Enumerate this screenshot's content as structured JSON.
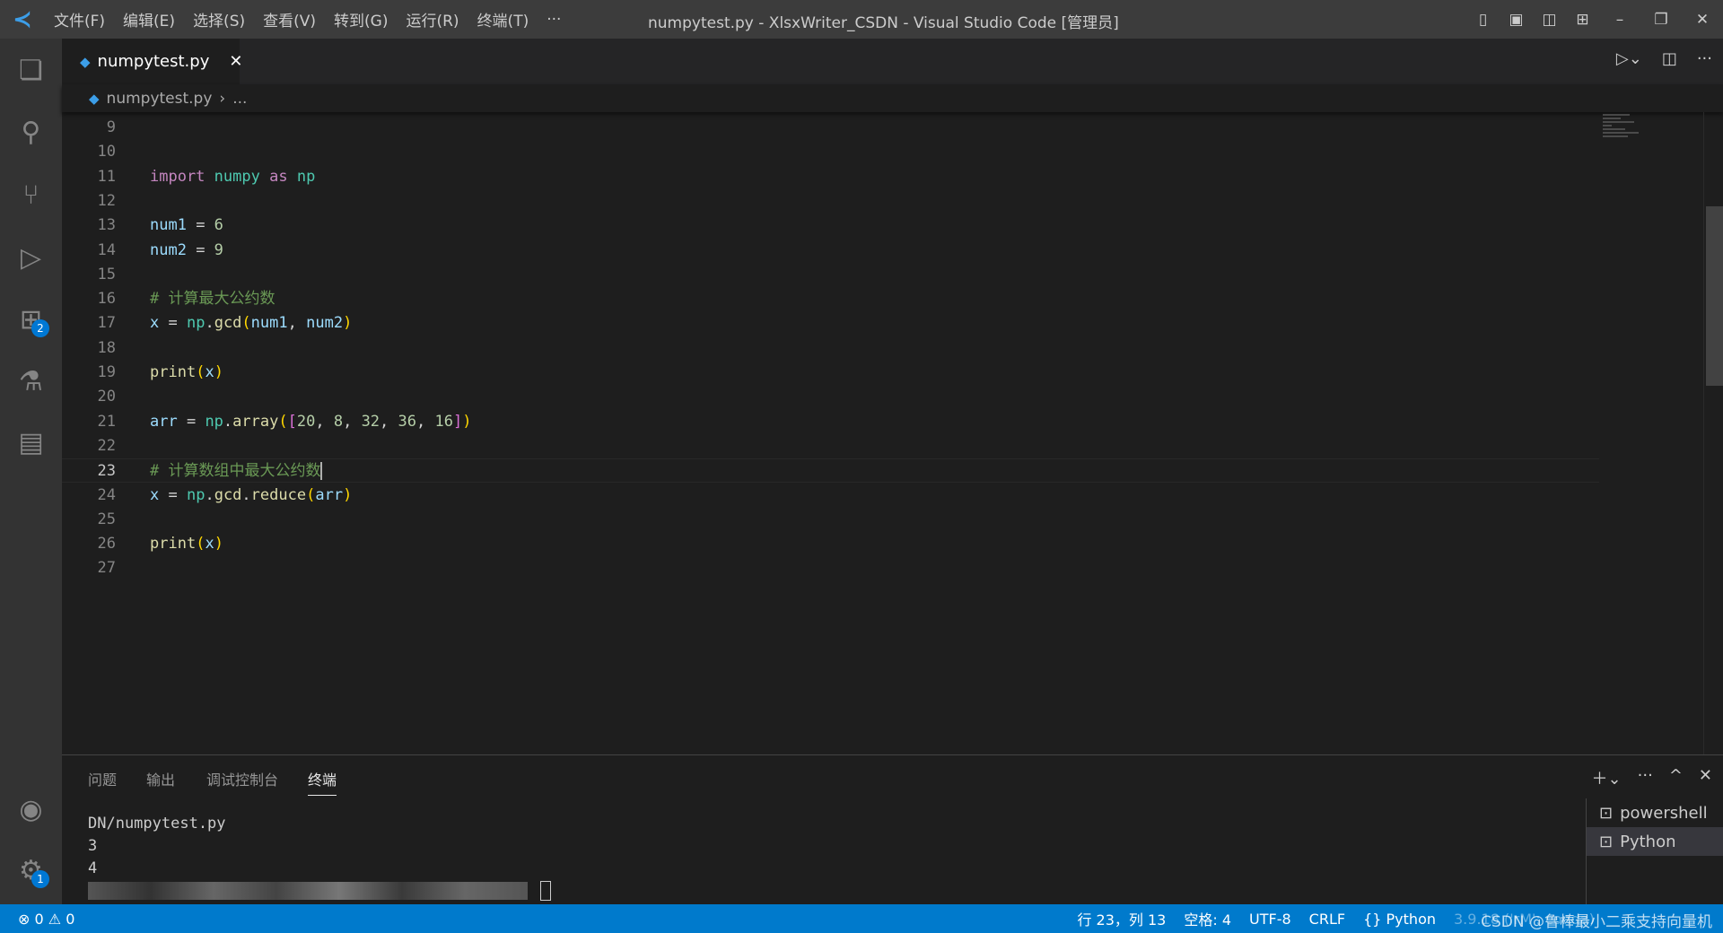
{
  "window": {
    "title": "numpytest.py - XlsxWriter_CSDN - Visual Studio Code [管理员]",
    "more": "···"
  },
  "menu": [
    "文件(F)",
    "编辑(E)",
    "选择(S)",
    "查看(V)",
    "转到(G)",
    "运行(R)",
    "终端(T)"
  ],
  "tab": {
    "label": "numpytest.py",
    "close": "✕"
  },
  "breadcrumb": {
    "file": "numpytest.py",
    "sep": "›",
    "rest": "..."
  },
  "activity": {
    "extensions_badge": "2",
    "settings_badge": "1"
  },
  "editor": {
    "current_line": 23,
    "lines": [
      {
        "n": "9",
        "t": []
      },
      {
        "n": "10",
        "t": []
      },
      {
        "n": "11",
        "t": [
          [
            "kw",
            "import"
          ],
          [
            "op",
            " "
          ],
          [
            "mod",
            "numpy"
          ],
          [
            "op",
            " "
          ],
          [
            "kw",
            "as"
          ],
          [
            "op",
            " "
          ],
          [
            "mod",
            "np"
          ]
        ]
      },
      {
        "n": "12",
        "t": []
      },
      {
        "n": "13",
        "t": [
          [
            "var",
            "num1"
          ],
          [
            "op",
            " = "
          ],
          [
            "num",
            "6"
          ]
        ]
      },
      {
        "n": "14",
        "t": [
          [
            "var",
            "num2"
          ],
          [
            "op",
            " = "
          ],
          [
            "num",
            "9"
          ]
        ]
      },
      {
        "n": "15",
        "t": []
      },
      {
        "n": "16",
        "t": [
          [
            "cm",
            "# 计算最大公约数"
          ]
        ]
      },
      {
        "n": "17",
        "t": [
          [
            "var",
            "x"
          ],
          [
            "op",
            " = "
          ],
          [
            "mod",
            "np"
          ],
          [
            "op",
            "."
          ],
          [
            "fn",
            "gcd"
          ],
          [
            "b1",
            "("
          ],
          [
            "var",
            "num1"
          ],
          [
            "op",
            ", "
          ],
          [
            "var",
            "num2"
          ],
          [
            "b1",
            ")"
          ]
        ]
      },
      {
        "n": "18",
        "t": []
      },
      {
        "n": "19",
        "t": [
          [
            "fn",
            "print"
          ],
          [
            "b1",
            "("
          ],
          [
            "var",
            "x"
          ],
          [
            "b1",
            ")"
          ]
        ]
      },
      {
        "n": "20",
        "t": []
      },
      {
        "n": "21",
        "t": [
          [
            "var",
            "arr"
          ],
          [
            "op",
            " = "
          ],
          [
            "mod",
            "np"
          ],
          [
            "op",
            "."
          ],
          [
            "fn",
            "array"
          ],
          [
            "b1",
            "("
          ],
          [
            "b2",
            "["
          ],
          [
            "num",
            "20"
          ],
          [
            "op",
            ", "
          ],
          [
            "num",
            "8"
          ],
          [
            "op",
            ", "
          ],
          [
            "num",
            "32"
          ],
          [
            "op",
            ", "
          ],
          [
            "num",
            "36"
          ],
          [
            "op",
            ", "
          ],
          [
            "num",
            "16"
          ],
          [
            "b2",
            "]"
          ],
          [
            "b1",
            ")"
          ]
        ]
      },
      {
        "n": "22",
        "t": []
      },
      {
        "n": "23",
        "t": [
          [
            "cm",
            "# 计算数组中最大公约数"
          ]
        ]
      },
      {
        "n": "24",
        "t": [
          [
            "var",
            "x"
          ],
          [
            "op",
            " = "
          ],
          [
            "mod",
            "np"
          ],
          [
            "op",
            "."
          ],
          [
            "fn",
            "gcd"
          ],
          [
            "op",
            "."
          ],
          [
            "fn",
            "reduce"
          ],
          [
            "b1",
            "("
          ],
          [
            "var",
            "arr"
          ],
          [
            "b1",
            ")"
          ]
        ]
      },
      {
        "n": "25",
        "t": []
      },
      {
        "n": "26",
        "t": [
          [
            "fn",
            "print"
          ],
          [
            "b1",
            "("
          ],
          [
            "var",
            "x"
          ],
          [
            "b1",
            ")"
          ]
        ]
      },
      {
        "n": "27",
        "t": []
      }
    ]
  },
  "panel": {
    "tabs": [
      "问题",
      "输出",
      "调试控制台",
      "终端"
    ],
    "active": "终端",
    "terminal_lines": [
      "DN/numpytest.py",
      "3",
      "4"
    ],
    "terminals": [
      "powershell",
      "Python"
    ]
  },
  "status": {
    "errors": "0",
    "warnings": "0",
    "position": "行 23，列 13",
    "indent": "空格: 4",
    "encoding": "UTF-8",
    "eol": "CRLF",
    "language": "Python",
    "interpreter": "3.9.18 ('rM': conda)",
    "watermark": "CSDN @鲁棒最小二乘支持向量机"
  },
  "colors": {
    "statusbar": "#007acc",
    "accent": "#0078d4"
  }
}
